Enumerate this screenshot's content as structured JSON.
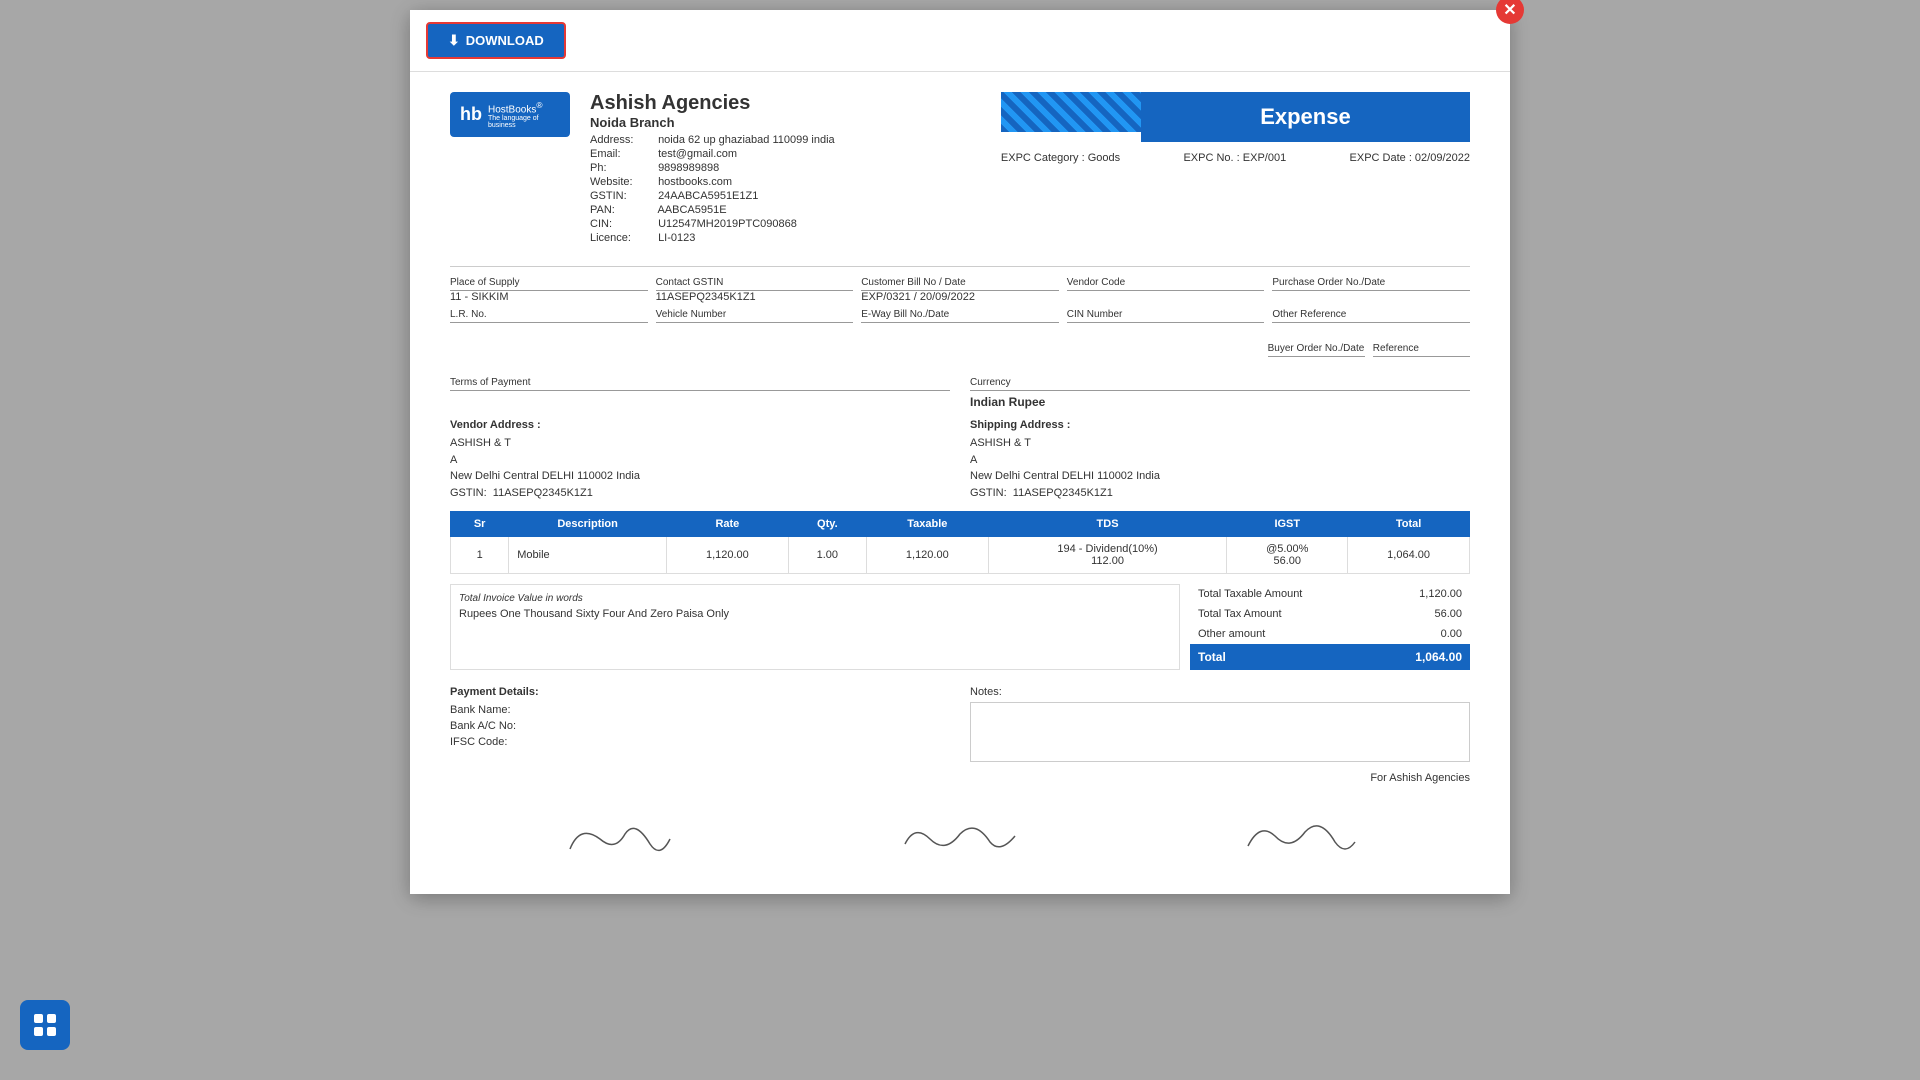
{
  "toolbar": {
    "download_label": "DOWNLOAD"
  },
  "company": {
    "name": "Ashish Agencies",
    "branch": "Noida Branch",
    "address": "noida 62 up ghaziabad 110099 india",
    "email": "test@gmail.com",
    "phone": "9898989898",
    "website": "hostbooks.com",
    "gstin": "24AABCA5951E1Z1",
    "pan": "AABCA5951E",
    "cin": "U12547MH2019PTC090868",
    "licence": "LI-0123"
  },
  "expense": {
    "title": "Expense",
    "category_label": "EXPC Category : Goods",
    "no_label": "EXPC No. : EXP/001",
    "date_label": "EXPC Date : 02/09/2022"
  },
  "details": {
    "place_of_supply_label": "Place of Supply",
    "place_of_supply_value": "11 - SIKKIM",
    "lr_no_label": "L.R. No.",
    "lr_no_value": "",
    "contact_gstin_label": "Contact GSTIN",
    "contact_gstin_value": "11ASEPQ2345K1Z1",
    "vehicle_number_label": "Vehicle Number",
    "vehicle_number_value": "",
    "customer_bill_label": "Customer Bill No / Date",
    "customer_bill_value": "EXP/0321 / 20/09/2022",
    "eway_bill_label": "E-Way Bill No./Date",
    "eway_bill_value": "",
    "vendor_code_label": "Vendor Code",
    "vendor_code_value": "",
    "cin_number_label": "CIN Number",
    "cin_number_value": "",
    "purchase_order_label": "Purchase Order No./Date",
    "purchase_order_value": "",
    "other_reference_label": "Other Reference",
    "other_reference_value": "",
    "buyer_order_label": "Buyer Order No./Date",
    "buyer_order_value": "",
    "reference_label": "Reference",
    "reference_value": ""
  },
  "terms": {
    "label": "Terms of Payment",
    "value": ""
  },
  "currency": {
    "label": "Currency",
    "value": "Indian Rupee"
  },
  "vendor_address": {
    "title": "Vendor Address :",
    "name": "ASHISH & T",
    "line2": "A",
    "city": "New Delhi Central DELHI 110002 India",
    "gstin_label": "GSTIN:",
    "gstin_value": "11ASEPQ2345K1Z1"
  },
  "shipping_address": {
    "title": "Shipping Address :",
    "name": "ASHISH & T",
    "line2": "A",
    "city": "New Delhi Central DELHI 110002 India",
    "gstin_label": "GSTIN:",
    "gstin_value": "11ASEPQ2345K1Z1"
  },
  "table": {
    "headers": [
      "Sr",
      "Description",
      "Rate",
      "Qty.",
      "Taxable",
      "TDS",
      "IGST",
      "Total"
    ],
    "rows": [
      {
        "sr": "1",
        "description": "Mobile",
        "rate": "1,120.00",
        "qty": "1.00",
        "taxable": "1,120.00",
        "tds": "194 - Dividend(10%)\n112.00",
        "igst": "@5.00%\n56.00",
        "total": "1,064.00"
      }
    ]
  },
  "invoice_words": {
    "title": "Total Invoice Value in words",
    "value": "Rupees One Thousand Sixty Four And Zero Paisa Only"
  },
  "totals": {
    "taxable_label": "Total Taxable Amount",
    "taxable_value": "1,120.00",
    "tax_label": "Total Tax Amount",
    "tax_value": "56.00",
    "other_label": "Other amount",
    "other_value": "0.00",
    "total_label": "Total",
    "total_value": "1,064.00"
  },
  "payment": {
    "title": "Payment Details:",
    "bank_name_label": "Bank Name:",
    "bank_ac_label": "Bank A/C No:",
    "ifsc_label": "IFSC Code:"
  },
  "notes": {
    "label": "Notes:"
  },
  "footer": {
    "for_company": "For Ashish Agencies"
  },
  "colors": {
    "primary": "#1565C0",
    "close": "#e53935"
  }
}
